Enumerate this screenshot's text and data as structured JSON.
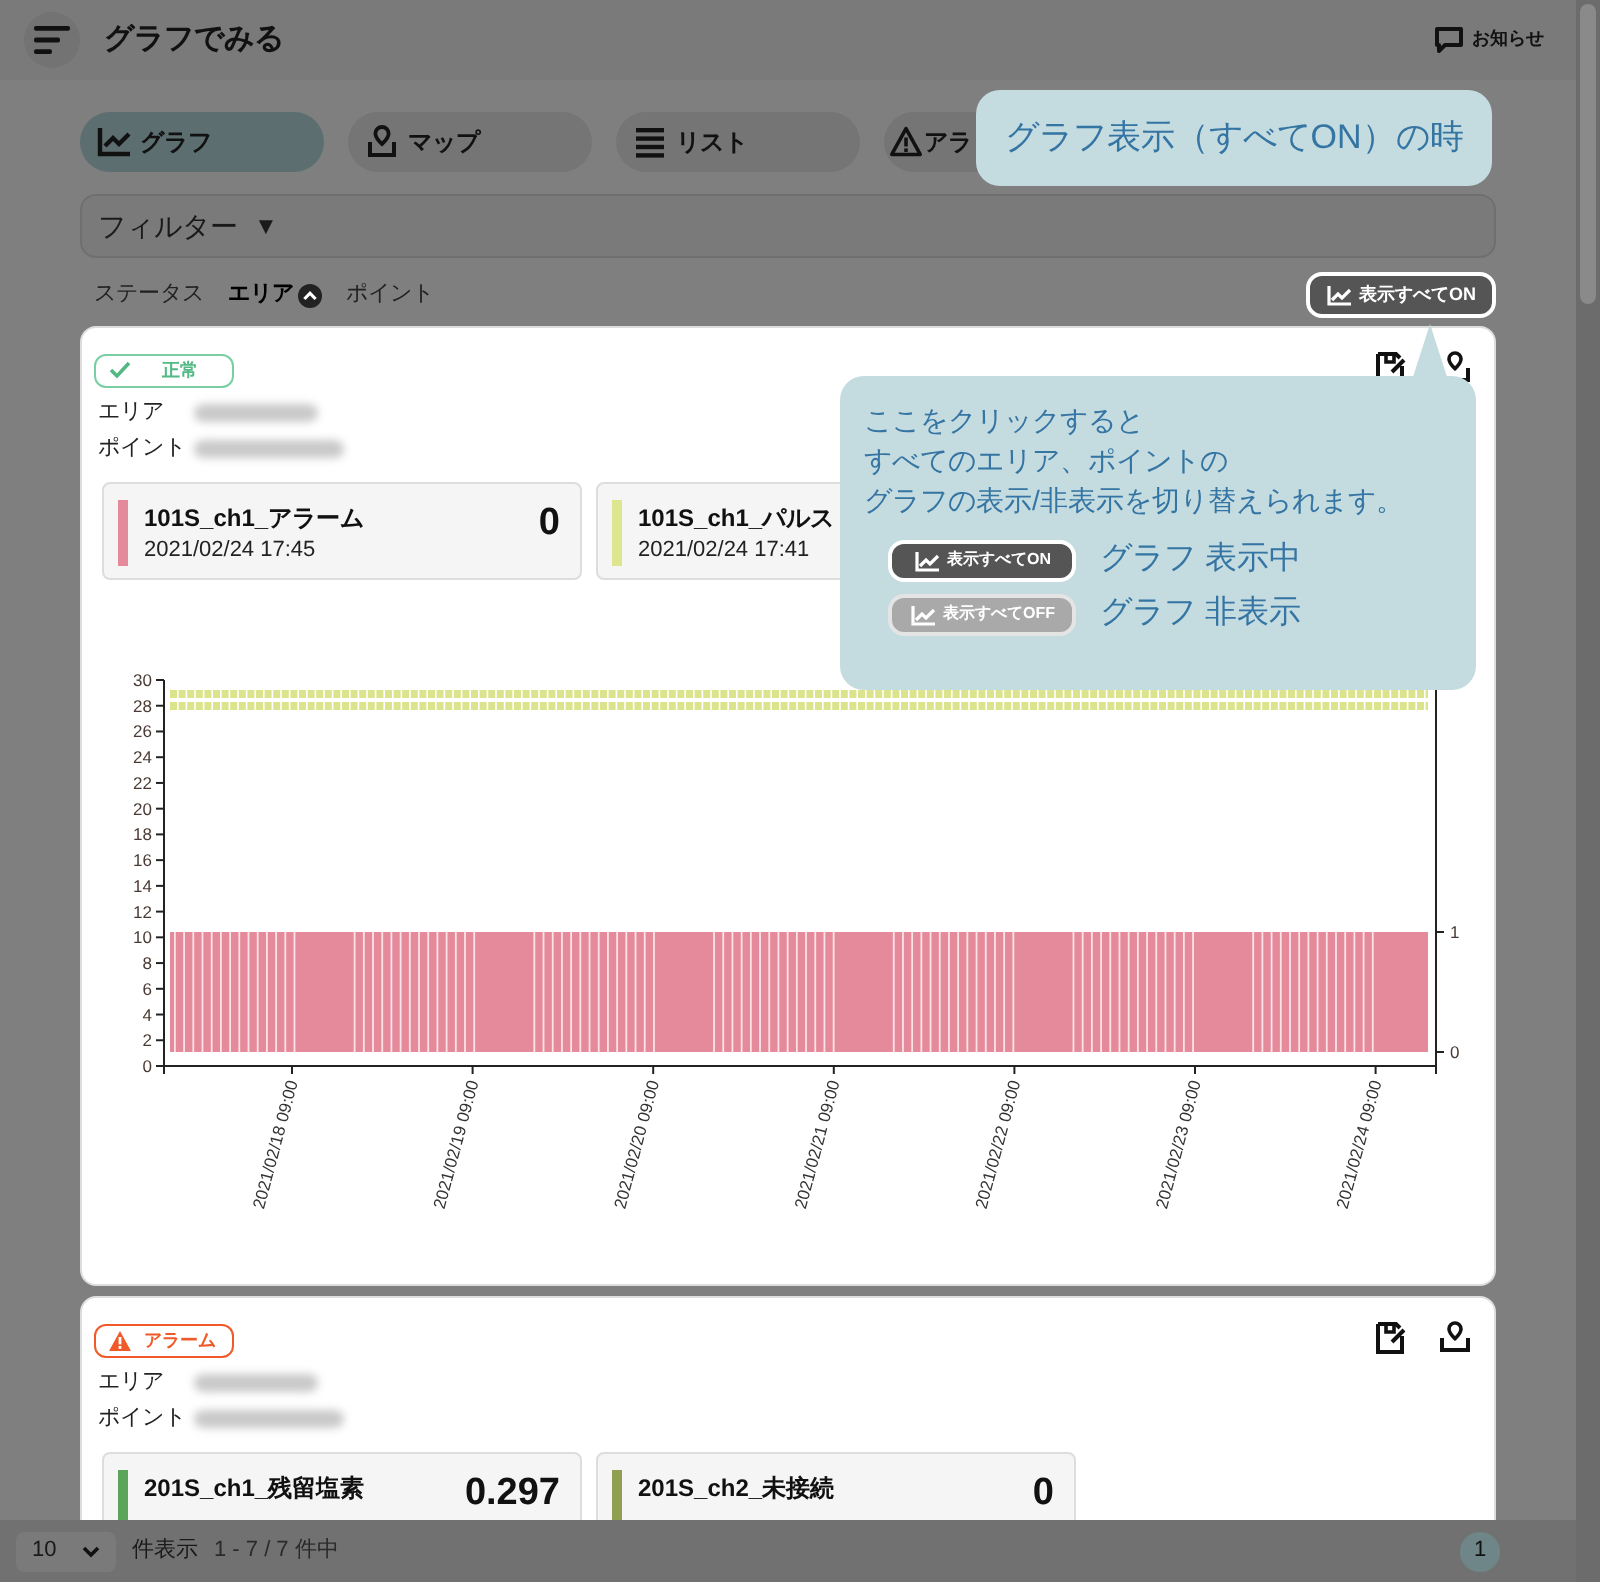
{
  "header": {
    "title": "グラフでみる",
    "notice": "お知らせ"
  },
  "tabs": [
    {
      "label": "グラフ",
      "selected": true
    },
    {
      "label": "マップ",
      "selected": false
    },
    {
      "label": "リスト",
      "selected": false
    },
    {
      "label": "アラ",
      "selected": false
    }
  ],
  "filter": {
    "label": "フィルター",
    "indicator": "▼"
  },
  "sort": [
    {
      "label": "ステータス",
      "selected": false
    },
    {
      "label": "エリア",
      "selected": true
    },
    {
      "label": "ポイント",
      "selected": false
    }
  ],
  "toggle_all": {
    "label": "表示すべてON",
    "on": true
  },
  "callouts": [
    {
      "text": "グラフ表示（すべてON）の時"
    },
    {
      "lines": [
        "ここをクリックすると",
        "すべてのエリア、ポイントの",
        "グラフの表示/非表示を切り替えられます。"
      ],
      "legend": [
        {
          "button": "表示すべてON",
          "on": true,
          "label": "グラフ 表示中"
        },
        {
          "button": "表示すべてOFF",
          "on": false,
          "label": "グラフ 非表示"
        }
      ]
    }
  ],
  "groups": [
    {
      "status": {
        "kind": "normal",
        "label": "正常"
      },
      "fields": [
        {
          "label": "エリア"
        },
        {
          "label": "ポイント"
        }
      ],
      "sensors": [
        {
          "name": "101S_ch1_アラーム",
          "time": "2021/02/24 17:45",
          "value": "0",
          "color": "#e48a9a"
        },
        {
          "name": "101S_ch1_パルス",
          "time": "2021/02/24 17:41",
          "color": "#dde68e"
        }
      ],
      "chart": {
        "y_labels": [
          "30",
          "28",
          "26",
          "24",
          "22",
          "20",
          "18",
          "16",
          "14",
          "12",
          "10",
          "8",
          "6",
          "4",
          "2",
          "0"
        ],
        "y2_labels": [
          "1",
          "0"
        ],
        "x_labels": [
          "2021/02/18 09:00",
          "2021/02/19 09:00",
          "2021/02/20 09:00",
          "2021/02/21 09:00",
          "2021/02/22 09:00",
          "2021/02/23 09:00",
          "2021/02/24 09:00"
        ]
      }
    },
    {
      "status": {
        "kind": "alarm",
        "label": "アラーム"
      },
      "fields": [
        {
          "label": "エリア"
        },
        {
          "label": "ポイント"
        }
      ],
      "sensors": [
        {
          "name": "201S_ch1_残留塩素",
          "value": "0.297",
          "color": "#5aa55a"
        },
        {
          "name": "201S_ch2_未接続",
          "value": "0",
          "color": "#8fa050"
        }
      ]
    }
  ],
  "footer": {
    "page_size": "10",
    "page_size_label": "件表示",
    "range": "1 - 7 / 7 件中",
    "pages": [
      {
        "label": "1",
        "selected": true
      }
    ]
  }
}
